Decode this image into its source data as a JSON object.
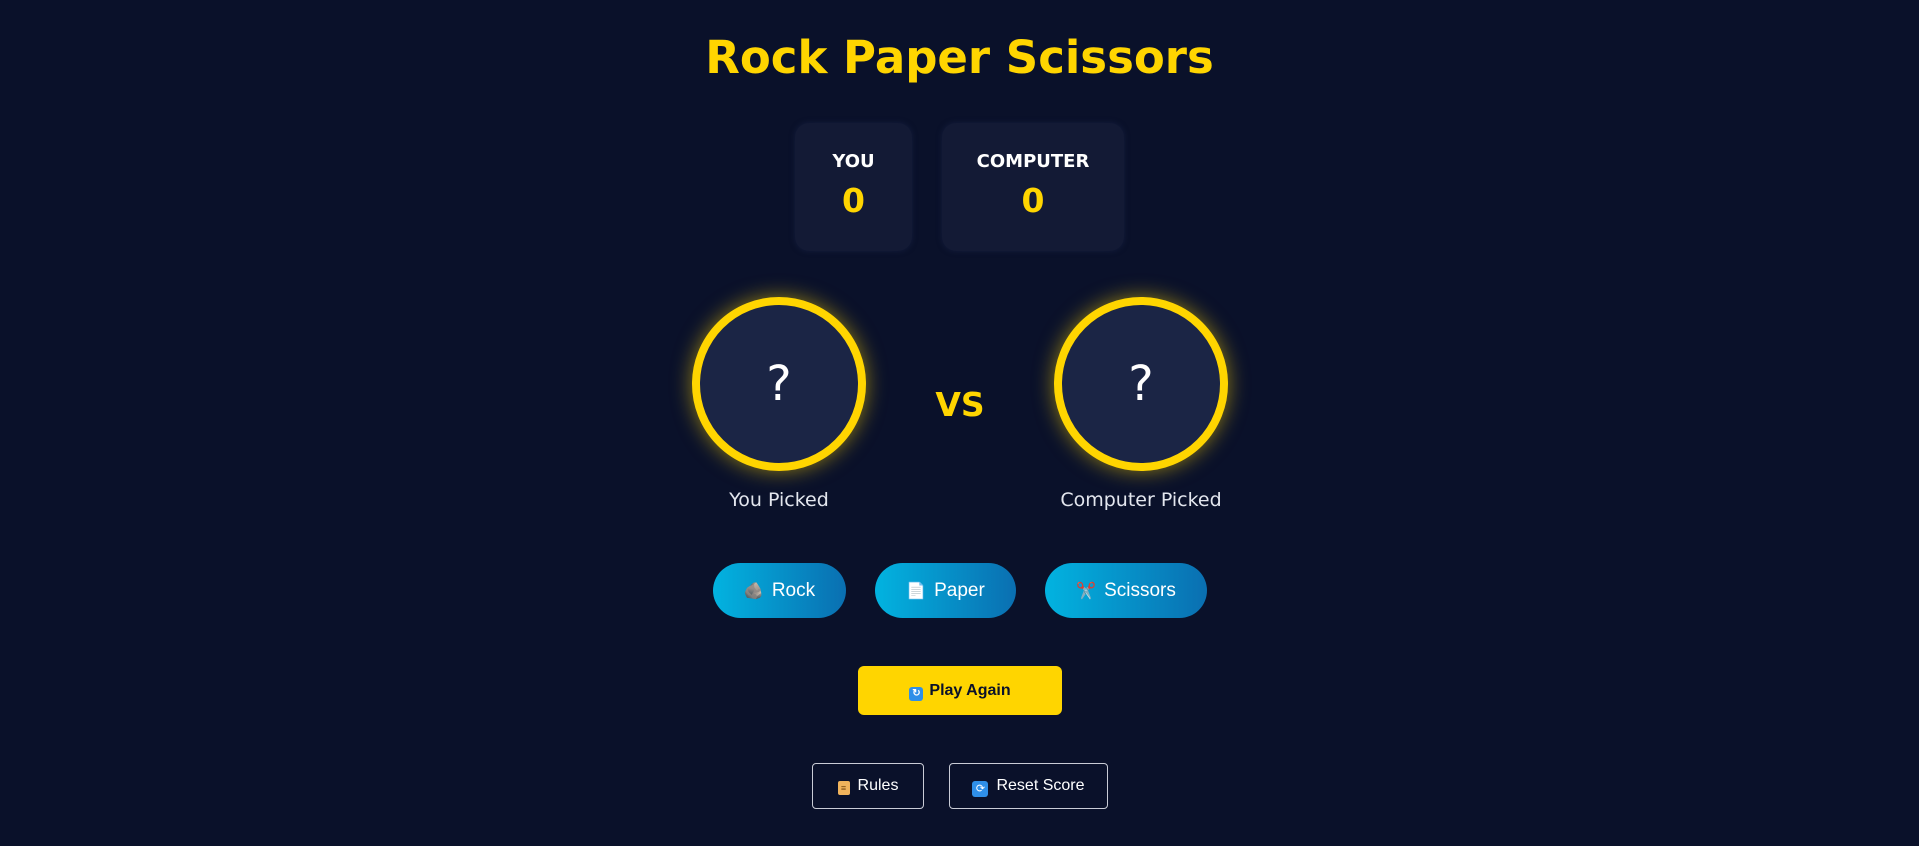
{
  "title": "Rock Paper Scissors",
  "scoreboard": {
    "you": {
      "label": "YOU",
      "score": "0"
    },
    "computer": {
      "label": "COMPUTER",
      "score": "0"
    }
  },
  "arena": {
    "you_pick": {
      "mark": "?",
      "label": "You Picked"
    },
    "vs": "VS",
    "computer_pick": {
      "mark": "?",
      "label": "Computer Picked"
    }
  },
  "choices": [
    {
      "label": "Rock",
      "icon": "rock-icon",
      "glyph": "🪨"
    },
    {
      "label": "Paper",
      "icon": "paper-icon",
      "glyph": "📄"
    },
    {
      "label": "Scissors",
      "icon": "scissors-icon",
      "glyph": "✂️"
    }
  ],
  "controls": {
    "play_again": {
      "label": "Play Again",
      "icon": "refresh-icon",
      "glyph": "🔄"
    },
    "rules": {
      "label": "Rules",
      "icon": "scroll-icon",
      "glyph": "📜"
    },
    "reset_score": {
      "label": "Reset Score",
      "icon": "repeat-icon",
      "glyph": "🔁"
    }
  },
  "colors": {
    "background": "#0a112a",
    "accent": "#ffd500",
    "card": "#131a35",
    "choice_gradient_start": "#02b3e0",
    "choice_gradient_end": "#0a6fb1"
  }
}
